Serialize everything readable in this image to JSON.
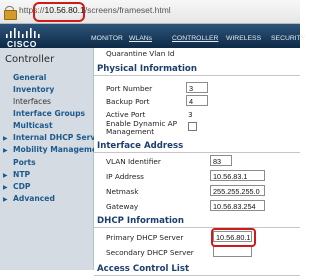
{
  "browser": {
    "url_scheme": "https://",
    "url_host": "10.56.80.1",
    "url_path": "/screens/frameset.html"
  },
  "header": {
    "logo_text": "CISCO",
    "nav": [
      "MONITOR",
      "WLANs",
      "CONTROLLER",
      "WIRELESS",
      "SECURITY"
    ]
  },
  "sidebar": {
    "title": "Controller",
    "items": [
      {
        "label": "General",
        "expandable": false
      },
      {
        "label": "Inventory",
        "expandable": false
      },
      {
        "label": "Interfaces",
        "expandable": false
      },
      {
        "label": "Interface Groups",
        "expandable": false
      },
      {
        "label": "Multicast",
        "expandable": false
      },
      {
        "label": "Internal DHCP Server",
        "expandable": true
      },
      {
        "label": "Mobility Management",
        "expandable": true
      },
      {
        "label": "Ports",
        "expandable": false
      },
      {
        "label": "NTP",
        "expandable": true
      },
      {
        "label": "CDP",
        "expandable": true
      },
      {
        "label": "Advanced",
        "expandable": true
      }
    ]
  },
  "main": {
    "top_label": "Quarantine Vlan Id",
    "physical": {
      "heading": "Physical Information",
      "port_number_label": "Port Number",
      "port_number": "3",
      "backup_port_label": "Backup Port",
      "backup_port": "4",
      "active_port_label": "Active Port",
      "active_port": "3",
      "dyn_ap_label_1": "Enable Dynamic AP",
      "dyn_ap_label_2": "Management"
    },
    "interface": {
      "heading": "Interface Address",
      "vlan_label": "VLAN Identifier",
      "vlan": "83",
      "ip_label": "IP Address",
      "ip": "10.56.83.1",
      "netmask_label": "Netmask",
      "netmask": "255.255.255.0",
      "gateway_label": "Gateway",
      "gateway": "10.56.83.254"
    },
    "dhcp": {
      "heading": "DHCP Information",
      "primary_label": "Primary DHCP Server",
      "primary": "10.56.80.1",
      "secondary_label": "Secondary DHCP Server",
      "secondary": ""
    },
    "acl": {
      "heading": "Access Control List"
    }
  },
  "colors": {
    "header_bg": "#1a3a5c",
    "sidebar_bg": "#d4dbe2",
    "link": "#1d5a8c",
    "highlight_ring": "#d01a1a"
  }
}
